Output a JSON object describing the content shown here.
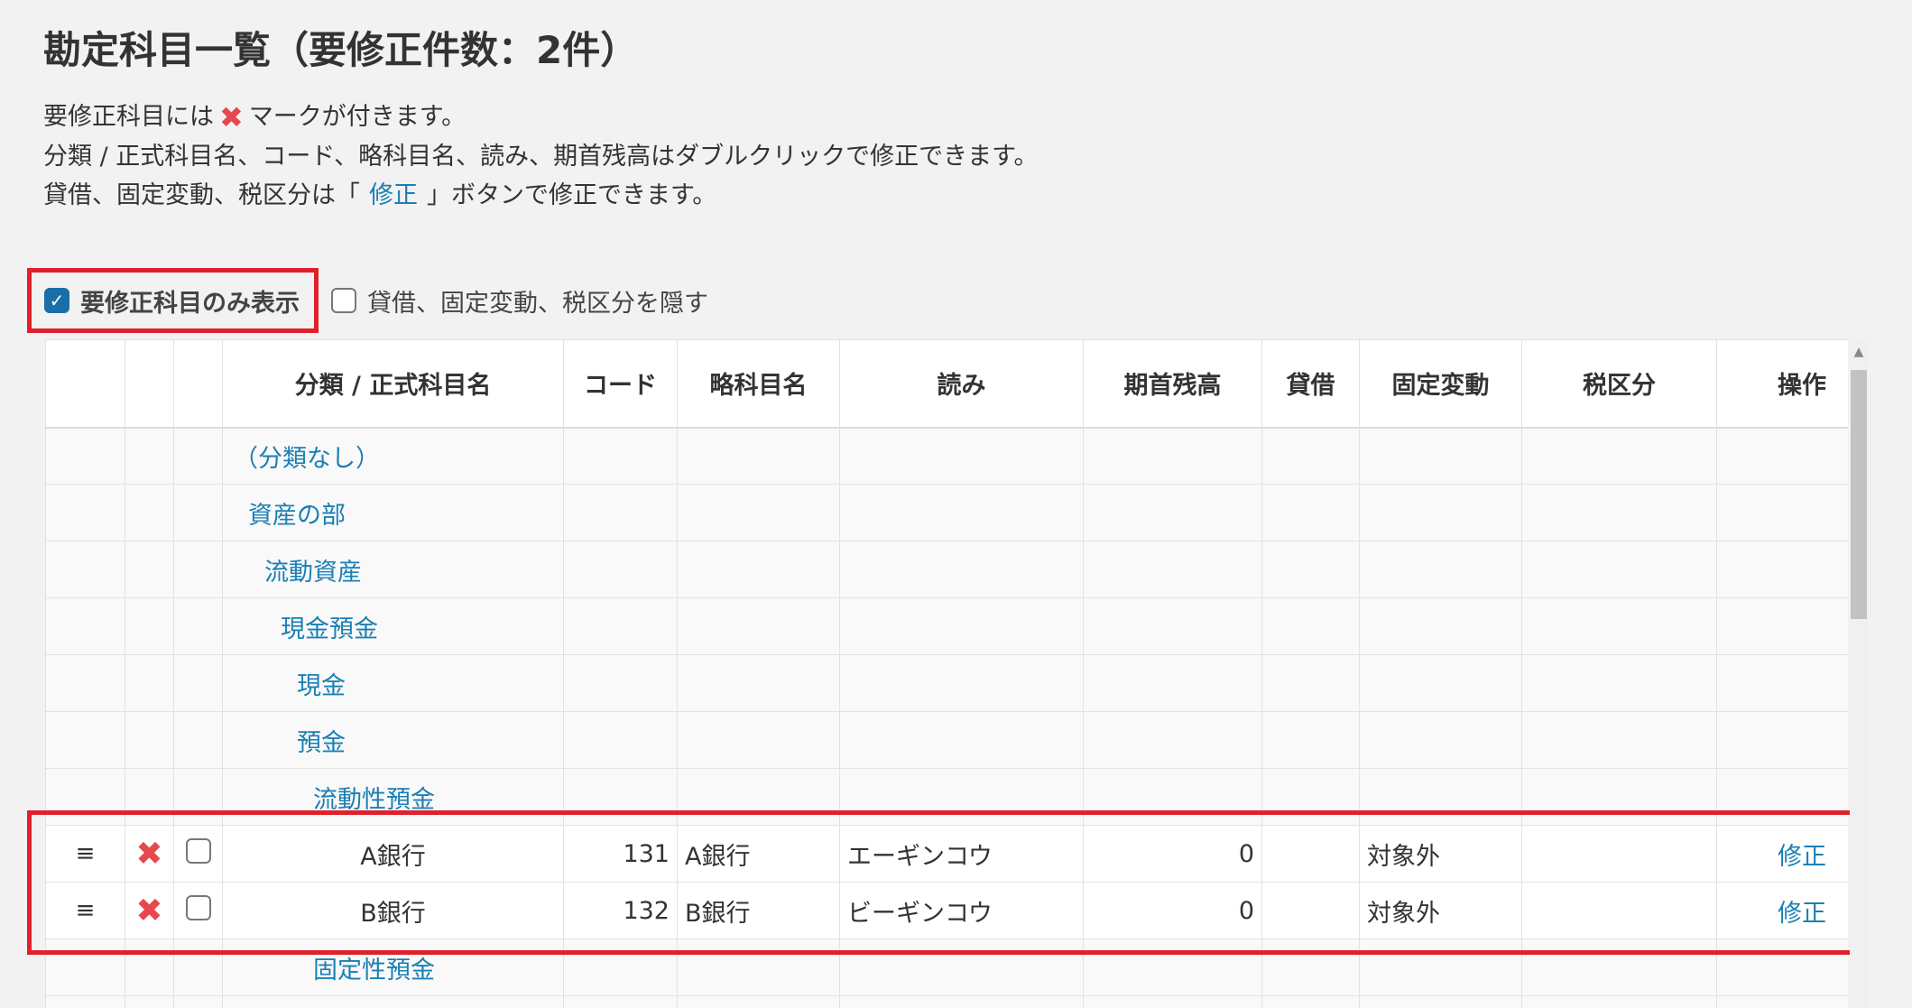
{
  "page": {
    "title": "勘定科目一覧（要修正件数：2件）",
    "desc1_before": "要修正科目には",
    "desc1_after": "マークが付きます。",
    "desc2": "分類 / 正式科目名、コード、略科目名、読み、期首残高はダブルクリックで修正できます。",
    "desc3_before": "貸借、固定変動、税区分は「",
    "desc3_link": "修正",
    "desc3_after": "」ボタンで修正できます。"
  },
  "options": {
    "show_only_fix": {
      "label": "要修正科目のみ表示",
      "checked": true
    },
    "hide_columns": {
      "label": "貸借、固定変動、税区分を隠す",
      "checked": false
    }
  },
  "table": {
    "headers": [
      "",
      "",
      "",
      "分類 / 正式科目名",
      "コード",
      "略科目名",
      "読み",
      "期首残高",
      "貸借",
      "固定変動",
      "税区分",
      "操作"
    ],
    "categories": [
      "（分類なし）",
      "資産の部",
      "流動資産",
      "現金預金",
      "現金",
      "預金",
      "流動性預金"
    ],
    "rows": [
      {
        "handle": "≡",
        "name": "A銀行",
        "code": "131",
        "short": "A銀行",
        "reading": "エーギンコウ",
        "balance": "0",
        "fixed": "対象外",
        "tax": "",
        "op": "修正"
      },
      {
        "handle": "≡",
        "name": "B銀行",
        "code": "132",
        "short": "B銀行",
        "reading": "ビーギンコウ",
        "balance": "0",
        "fixed": "対象外",
        "tax": "",
        "op": "修正"
      }
    ],
    "after_category": "固定性預金"
  },
  "colors": {
    "error_mark": "#e5484d",
    "link": "#1a7fb4",
    "highlight": "#e0202a",
    "dc_error": "#ff5f5f"
  }
}
